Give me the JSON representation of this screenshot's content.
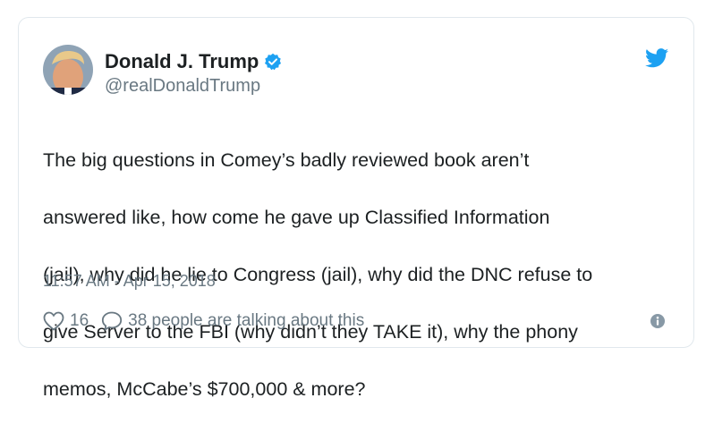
{
  "author": {
    "name": "Donald J. Trump",
    "handle": "@realDonaldTrump",
    "verified": true
  },
  "tweet": {
    "lines": [
      "The big questions in Comey’s badly reviewed book aren’t",
      "answered like, how come he gave up Classified Information",
      "(jail), why did he lie to Congress (jail), why did the DNC refuse to",
      "give Server to the FBI (why didn’t they TAKE it), why the phony",
      "memos, McCabe’s $700,000 & more?"
    ],
    "timestamp": "11:57 AM - Apr 15, 2018"
  },
  "actions": {
    "like_count": "16",
    "talk_text": "38 people are talking about this"
  },
  "icons": {
    "verified": "verified-badge-icon",
    "twitter": "twitter-bird-icon",
    "like": "heart-icon",
    "reply": "speech-bubble-icon",
    "info": "info-icon"
  },
  "colors": {
    "brand_blue": "#1da1f2",
    "text": "#1c2022",
    "secondary": "#697882",
    "border": "#e1e8ed"
  }
}
